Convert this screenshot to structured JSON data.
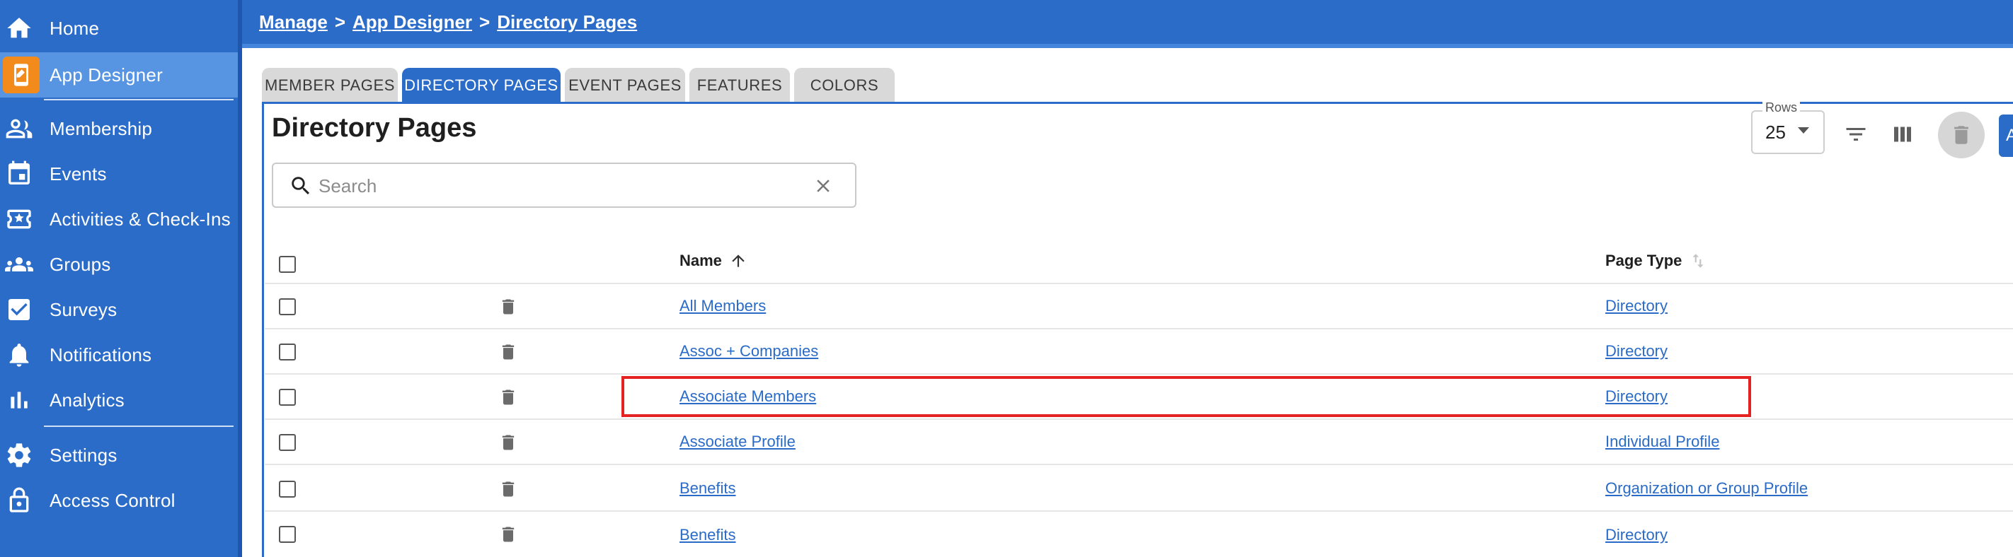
{
  "sidebar": {
    "items": [
      {
        "label": "Home",
        "icon": "home-icon"
      },
      {
        "label": "App Designer",
        "icon": "app-designer-icon",
        "active": true
      },
      {
        "label": "Membership",
        "icon": "people-icon"
      },
      {
        "label": "Events",
        "icon": "calendar-icon"
      },
      {
        "label": "Activities & Check-Ins",
        "icon": "ticket-star-icon"
      },
      {
        "label": "Groups",
        "icon": "groups-icon"
      },
      {
        "label": "Surveys",
        "icon": "checkbox-icon"
      },
      {
        "label": "Notifications",
        "icon": "bell-icon"
      },
      {
        "label": "Analytics",
        "icon": "bar-chart-icon"
      },
      {
        "label": "Settings",
        "icon": "gear-icon"
      },
      {
        "label": "Access Control",
        "icon": "lock-icon"
      }
    ]
  },
  "breadcrumb": {
    "manage": "Manage",
    "sep1": ">",
    "app_designer": "App Designer",
    "sep2": ">",
    "directory_pages": "Directory Pages"
  },
  "tabs": [
    {
      "label": "MEMBER PAGES"
    },
    {
      "label": "DIRECTORY PAGES",
      "active": true
    },
    {
      "label": "EVENT PAGES"
    },
    {
      "label": "FEATURES"
    },
    {
      "label": "COLORS"
    }
  ],
  "panel": {
    "title": "Directory Pages",
    "search_placeholder": "Search",
    "rows_label": "Rows",
    "rows_value": "25",
    "add_button_partial": "A"
  },
  "table": {
    "columns": {
      "name": "Name",
      "page_type": "Page Type"
    },
    "rows": [
      {
        "name": "All Members",
        "page_type": "Directory"
      },
      {
        "name": "Assoc + Companies",
        "page_type": "Directory"
      },
      {
        "name": "Associate Members",
        "page_type": "Directory",
        "highlighted": true
      },
      {
        "name": "Associate Profile",
        "page_type": "Individual Profile"
      },
      {
        "name": "Benefits",
        "page_type": "Organization or Group Profile"
      },
      {
        "name": "Benefits",
        "page_type": "Directory"
      }
    ]
  },
  "colors": {
    "brand_blue": "#2b6cc9",
    "active_nav": "#5795e3",
    "app_designer_badge": "#f28b1c",
    "highlight_border": "#e52222",
    "link": "#2a6bc7"
  }
}
